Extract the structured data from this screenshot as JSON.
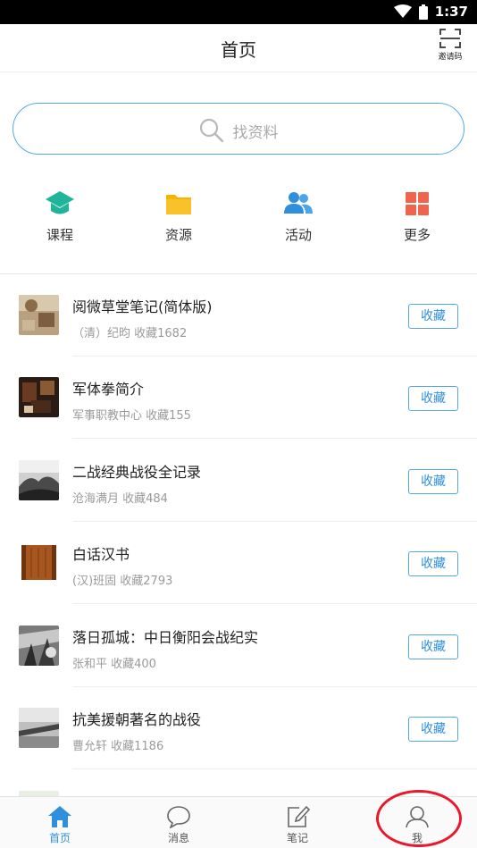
{
  "status_bar": {
    "time": "1:37"
  },
  "header": {
    "title": "首页",
    "invite_label": "邀请码"
  },
  "search": {
    "placeholder": "找资料"
  },
  "categories": [
    {
      "label": "课程",
      "icon": "graduation-cap-icon",
      "color": "#1fb59a"
    },
    {
      "label": "资源",
      "icon": "folder-icon",
      "color": "#f5b400"
    },
    {
      "label": "活动",
      "icon": "people-icon",
      "color": "#2f8fdc"
    },
    {
      "label": "更多",
      "icon": "grid-icon",
      "color": "#f0644e"
    }
  ],
  "resources": [
    {
      "title": "阅微草堂笔记(简体版)",
      "meta": "（清）纪昀 收藏1682",
      "button": "收藏"
    },
    {
      "title": "军体拳简介",
      "meta": "军事职教中心 收藏155",
      "button": "收藏"
    },
    {
      "title": "二战经典战役全记录",
      "meta": "沧海满月 收藏484",
      "button": "收藏"
    },
    {
      "title": "白话汉书",
      "meta": "(汉)班固 收藏2793",
      "button": "收藏"
    },
    {
      "title": "落日孤城：中日衡阳会战纪实",
      "meta": "张和平 收藏400",
      "button": "收藏"
    },
    {
      "title": "抗美援朝著名的战役",
      "meta": "曹允轩 收藏1186",
      "button": "收藏"
    }
  ],
  "bottom_nav": [
    {
      "label": "首页",
      "icon": "home-icon",
      "active": true
    },
    {
      "label": "消息",
      "icon": "chat-bubble-icon",
      "active": false
    },
    {
      "label": "笔记",
      "icon": "edit-note-icon",
      "active": false
    },
    {
      "label": "我",
      "icon": "user-icon",
      "active": false
    }
  ],
  "colors": {
    "accent": "#2f8fdc",
    "annotation": "#e8192c"
  }
}
